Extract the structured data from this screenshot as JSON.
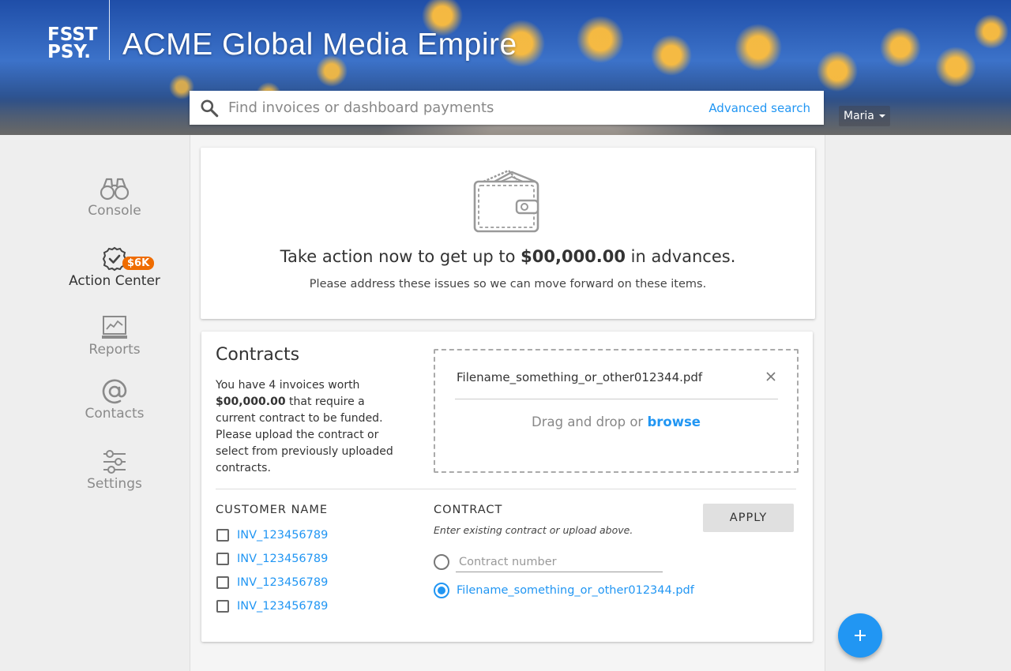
{
  "header": {
    "logo_line1": "FSST",
    "logo_line2": "PSY.",
    "title": "ACME Global Media Empire"
  },
  "search": {
    "placeholder": "Find invoices or dashboard payments",
    "value": "",
    "advanced_label": "Advanced search"
  },
  "user": {
    "name": "Maria"
  },
  "sidebar": {
    "items": [
      {
        "label": "Console",
        "icon": "binoculars-icon"
      },
      {
        "label": "Action Center",
        "icon": "check-circle-icon",
        "badge": "$6K"
      },
      {
        "label": "Reports",
        "icon": "chart-monitor-icon"
      },
      {
        "label": "Contacts",
        "icon": "at-sign-icon"
      },
      {
        "label": "Settings",
        "icon": "sliders-icon"
      }
    ],
    "active": "Action Center"
  },
  "promo": {
    "title_pre": "Take action now to get up to ",
    "title_amount": "$00,000.00",
    "title_post": " in advances.",
    "subtitle": "Please address these issues so we can move forward on these items."
  },
  "contracts": {
    "title": "Contracts",
    "desc_pre": "You have 4 invoices worth ",
    "desc_amount": "$00,000.00",
    "desc_post": " that require a current contract to be funded. Please upload the contract or select from previously uploaded contracts.",
    "uploaded_file": "Filename_something_or_other012344.pdf",
    "drag_text": "Drag and drop or ",
    "browse_label": "browse",
    "customer_label": "CUSTOMER NAME",
    "contract_label": "CONTRACT",
    "contract_hint": "Enter existing contract or upload above.",
    "apply_label": "APPLY",
    "invoices": [
      "INV_123456789",
      "INV_123456789",
      "INV_123456789",
      "INV_123456789"
    ],
    "contract_number_placeholder": "Contract number",
    "contract_number_value": "",
    "selected_file_option": "Filename_something_or_other012344.pdf"
  },
  "colors": {
    "accent": "#2196f3",
    "badge": "#ef6c00"
  }
}
